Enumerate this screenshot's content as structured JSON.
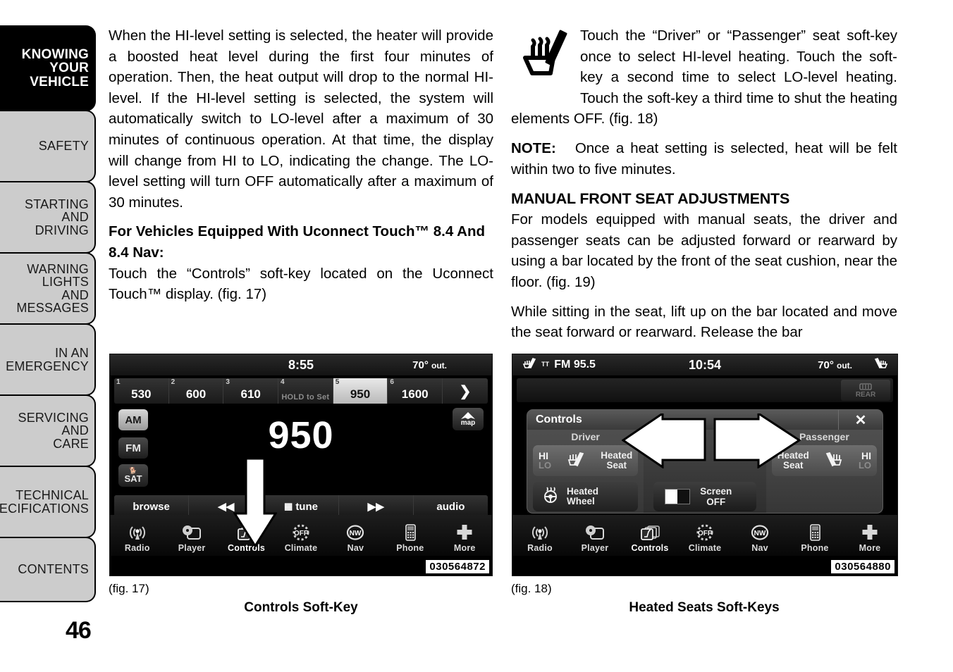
{
  "page": {
    "number": "46"
  },
  "sidebar": {
    "items": [
      {
        "label": "KNOWING\nYOUR\nVEHICLE",
        "current": true
      },
      {
        "label": "SAFETY",
        "current": false
      },
      {
        "label": "STARTING\nAND\nDRIVING",
        "current": false
      },
      {
        "label": "WARNING\nLIGHTS\nAND\nMESSAGES",
        "current": false
      },
      {
        "label": "IN AN\nEMERGENCY",
        "current": false
      },
      {
        "label": "SERVICING\nAND\nCARE",
        "current": false
      },
      {
        "label": "TECHNICAL\nSPECIFICATIONS",
        "current": false
      },
      {
        "label": "CONTENTS",
        "current": false
      }
    ]
  },
  "left_column": {
    "para1": "When the HI-level setting is selected, the heater will provide a boosted heat level during the first four minutes of operation. Then, the heat output will drop to the normal HI-level. If the HI-level setting is selected, the system will automatically switch to LO-level after a maximum of 30 minutes of continuous operation. At that time, the display will change from HI to LO, indicating the change. The LO-level setting will turn OFF automatically after a maximum of 30 minutes.",
    "subheading": "For Vehicles Equipped With Uconnect Touch™ 8.4 And 8.4 Nav:",
    "para2": "Touch the “Controls” soft-key located on the Uconnect Touch™ display.  (fig. 17)"
  },
  "right_column": {
    "para1": "Touch the “Driver” or “Passenger” seat soft-key once to select HI-level heating. Touch the soft-key a second time to select LO-level heating. Touch the soft-key a third time to shut the heating elements OFF.  (fig. 18)",
    "note_label": "NOTE:",
    "note_text": "Once a heat setting is selected, heat will be felt within two to five minutes.",
    "heading": "MANUAL FRONT SEAT ADJUSTMENTS",
    "para2": "For models equipped with manual seats, the driver and passenger seats can be adjusted forward or rearward by using a bar located by the front of the seat cushion, near the floor.  (fig. 19)",
    "para3": "While sitting in the seat, lift up on the bar located and move the seat forward or rearward. Release the bar"
  },
  "figure17": {
    "ref": "(fig. 17)",
    "caption": "Controls Soft-Key",
    "part_number": "030564872",
    "status": {
      "time": "8:55",
      "temp": "70°",
      "temp_unit": "out."
    },
    "presets": [
      {
        "num": "1",
        "value": "530",
        "active": false,
        "dim": false
      },
      {
        "num": "2",
        "value": "600",
        "active": false,
        "dim": false
      },
      {
        "num": "3",
        "value": "610",
        "active": false,
        "dim": false
      },
      {
        "num": "4",
        "value": "HOLD to Set",
        "active": false,
        "dim": true
      },
      {
        "num": "5",
        "value": "950",
        "active": true,
        "dim": false
      },
      {
        "num": "6",
        "value": "1600",
        "active": false,
        "dim": false
      }
    ],
    "preset_next": "❯",
    "band_buttons": [
      {
        "label": "AM",
        "active": true
      },
      {
        "label": "FM",
        "active": false
      },
      {
        "label": "SAT",
        "active": false
      }
    ],
    "map_button": "map",
    "frequency": "950",
    "transport": [
      {
        "label": "browse",
        "icon": "none"
      },
      {
        "label": "",
        "icon": "prev-track-icon"
      },
      {
        "label": "tune",
        "icon": "grid-icon"
      },
      {
        "label": "",
        "icon": "next-track-icon"
      },
      {
        "label": "audio",
        "icon": "none"
      }
    ],
    "apps": [
      {
        "label": "Radio",
        "icon": "radio-icon",
        "highlight": false
      },
      {
        "label": "Player",
        "icon": "player-icon",
        "highlight": false
      },
      {
        "label": "Controls",
        "icon": "controls-icon",
        "highlight": true
      },
      {
        "label": "Climate",
        "icon": "climate-off-icon",
        "highlight": false
      },
      {
        "label": "Nav",
        "icon": "nav-compass-icon",
        "highlight": false
      },
      {
        "label": "Phone",
        "icon": "phone-icon",
        "highlight": false
      },
      {
        "label": "More",
        "icon": "plus-icon",
        "highlight": false
      }
    ]
  },
  "figure18": {
    "ref": "(fig. 18)",
    "caption": "Heated Seats Soft-Keys",
    "part_number": "030564880",
    "status": {
      "source": "FM 95.5",
      "time": "10:54",
      "temp": "70°",
      "temp_unit": "out."
    },
    "rear_label": "REAR",
    "panel": {
      "title": "Controls",
      "close": "✕",
      "driver_title": "Driver",
      "passenger_title": "Passenger",
      "hi": "HI",
      "lo": "LO",
      "heated_seat_line1": "Heated",
      "heated_seat_line2": "Seat",
      "heated_wheel_line1": "Heated",
      "heated_wheel_line2": "Wheel",
      "screen_line1": "Screen",
      "screen_line2": "OFF"
    },
    "apps": [
      {
        "label": "Radio",
        "icon": "radio-icon",
        "highlight": false
      },
      {
        "label": "Player",
        "icon": "player-icon",
        "highlight": false
      },
      {
        "label": "Controls",
        "icon": "controls-icon",
        "highlight": true
      },
      {
        "label": "Climate",
        "icon": "climate-off-icon",
        "highlight": false
      },
      {
        "label": "Nav",
        "icon": "nav-compass-icon",
        "highlight": false
      },
      {
        "label": "Phone",
        "icon": "phone-icon",
        "highlight": false
      },
      {
        "label": "More",
        "icon": "plus-icon",
        "highlight": false
      }
    ]
  }
}
